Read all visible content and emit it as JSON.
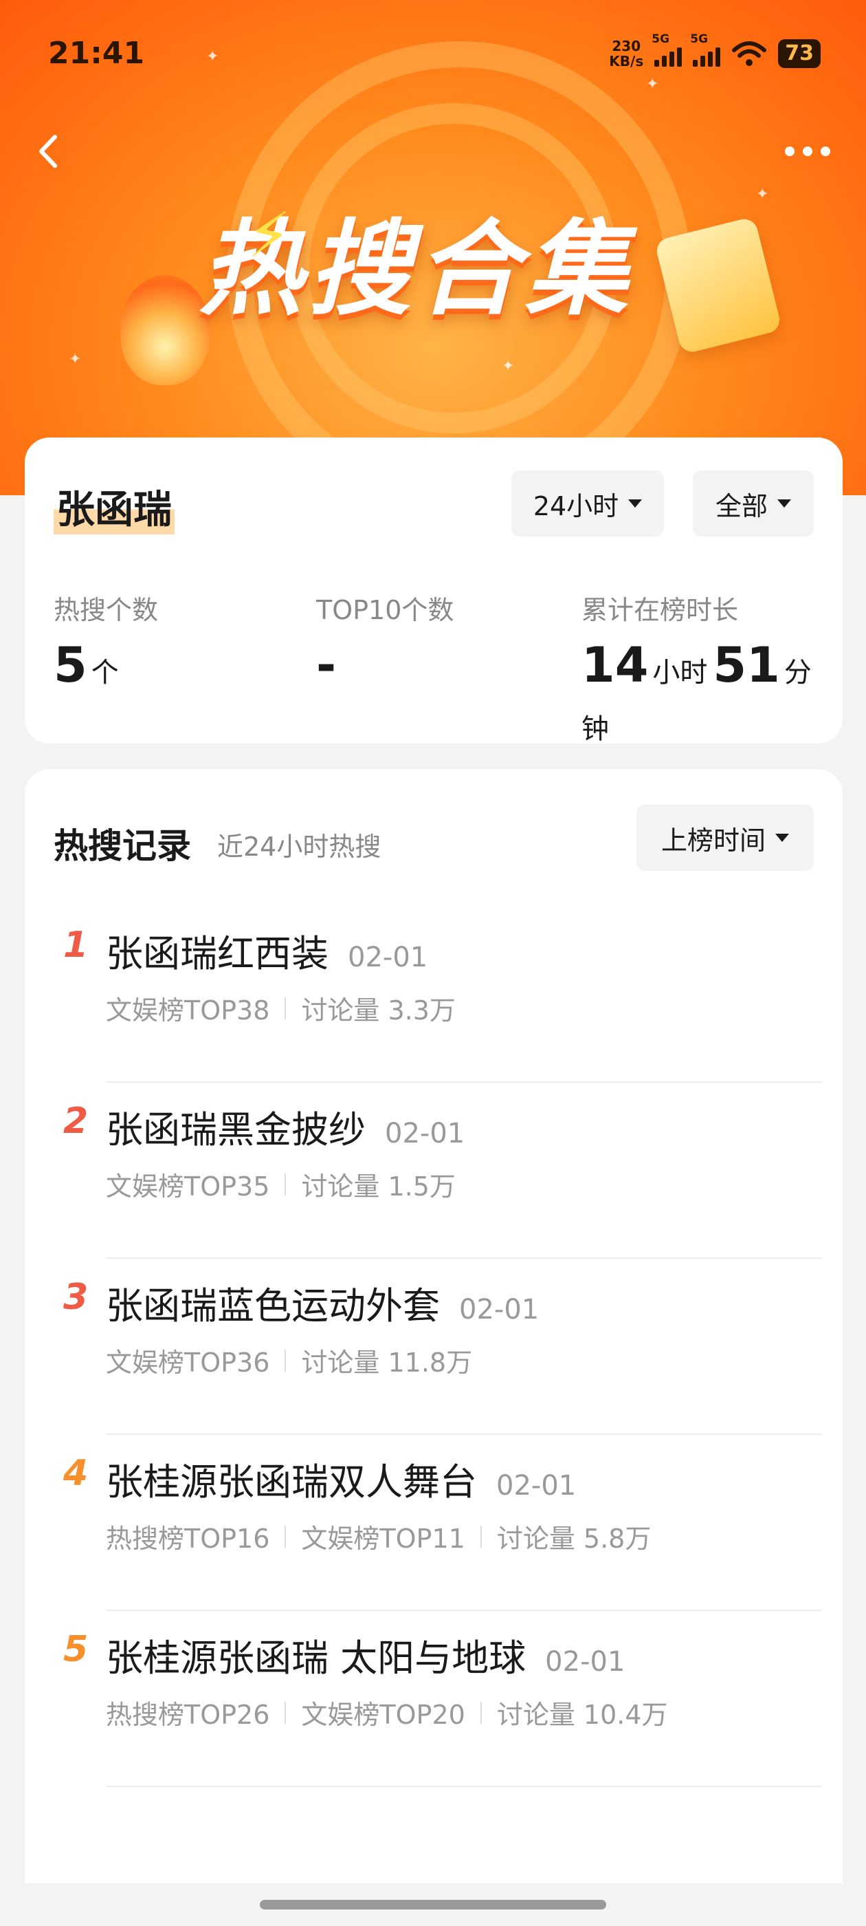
{
  "status_bar": {
    "time": "21:41",
    "speed_value": "230",
    "speed_unit": "KB/s",
    "signal1_label": "5G",
    "signal2_label": "5G",
    "battery": "73"
  },
  "header": {
    "banner_title": "热搜合集",
    "back_icon": "chevron-left-icon",
    "more_icon": "more-dots-icon"
  },
  "profile": {
    "name": "张函瑞",
    "time_filter": "24小时",
    "scope_filter": "全部"
  },
  "stats": {
    "hot_count_label": "热搜个数",
    "hot_count_value": "5",
    "hot_count_unit": "个",
    "top10_label": "TOP10个数",
    "top10_value": "-",
    "duration_label": "累计在榜时长",
    "duration_hours": "14",
    "duration_hours_unit": "小时",
    "duration_minutes": "51",
    "duration_minutes_unit": "分钟"
  },
  "records": {
    "title": "热搜记录",
    "subtitle": "近24小时热搜",
    "sort_label": "上榜时间",
    "items": [
      {
        "rank": "1",
        "title": "张函瑞红西装",
        "date": "02-01",
        "meta": [
          "文娱榜TOP38",
          "讨论量 3.3万"
        ]
      },
      {
        "rank": "2",
        "title": "张函瑞黑金披纱",
        "date": "02-01",
        "meta": [
          "文娱榜TOP35",
          "讨论量 1.5万"
        ]
      },
      {
        "rank": "3",
        "title": "张函瑞蓝色运动外套",
        "date": "02-01",
        "meta": [
          "文娱榜TOP36",
          "讨论量 11.8万"
        ]
      },
      {
        "rank": "4",
        "title": "张桂源张函瑞双人舞台",
        "date": "02-01",
        "meta": [
          "热搜榜TOP16",
          "文娱榜TOP11",
          "讨论量 5.8万"
        ]
      },
      {
        "rank": "5",
        "title": "张桂源张函瑞 太阳与地球",
        "date": "02-01",
        "meta": [
          "热搜榜TOP26",
          "文娱榜TOP20",
          "讨论量 10.4万"
        ]
      }
    ]
  },
  "colors": {
    "rank_top3": "#ef5b45",
    "rank_other": "#f7902c",
    "banner_orange": "#ff7a14"
  }
}
